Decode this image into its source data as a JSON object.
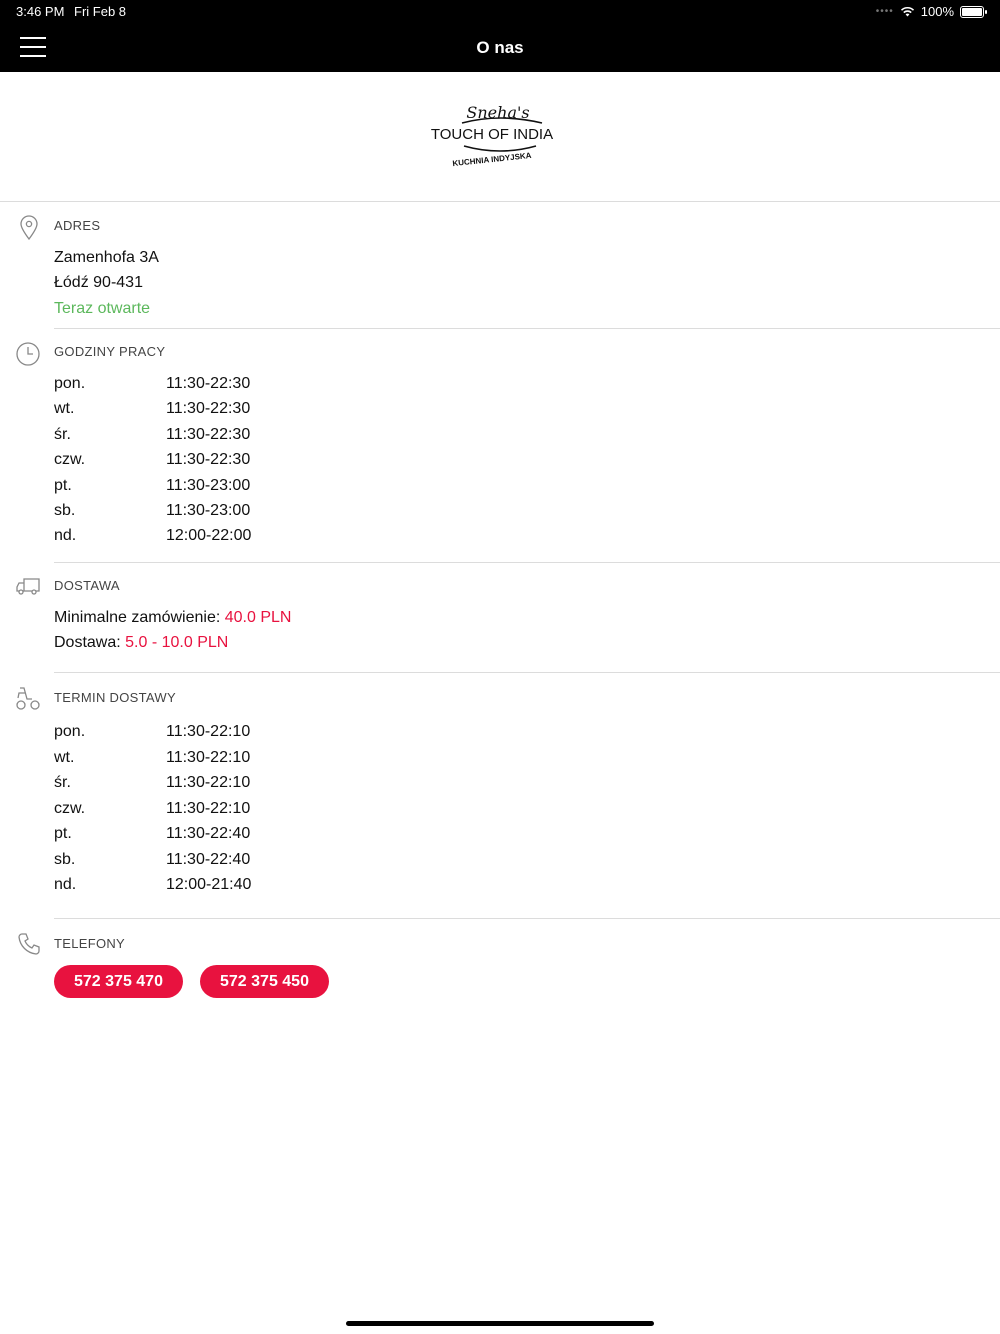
{
  "status_bar": {
    "time": "3:46 PM",
    "date": "Fri Feb 8",
    "battery": "100%"
  },
  "nav": {
    "title": "O nas"
  },
  "logo": {
    "script": "Sneha's",
    "name": "TOUCH OF INDIA",
    "tagline": "KUCHNIA INDYJSKA"
  },
  "address": {
    "title": "ADRES",
    "street": "Zamenhofa 3A",
    "city": "Łódź 90-431",
    "status": "Teraz otwarte"
  },
  "opening_hours": {
    "title": "GODZINY PRACY",
    "rows": [
      {
        "day": "pon.",
        "hours": "11:30-22:30"
      },
      {
        "day": "wt.",
        "hours": "11:30-22:30"
      },
      {
        "day": "śr.",
        "hours": "11:30-22:30"
      },
      {
        "day": "czw.",
        "hours": "11:30-22:30"
      },
      {
        "day": "pt.",
        "hours": "11:30-23:00"
      },
      {
        "day": "sb.",
        "hours": "11:30-23:00"
      },
      {
        "day": "nd.",
        "hours": "12:00-22:00"
      }
    ]
  },
  "delivery": {
    "title": "DOSTAWA",
    "min_order_label": "Minimalne zamówienie:",
    "min_order_value": "40.0 PLN",
    "fee_label": "Dostawa:",
    "fee_value": "5.0 - 10.0 PLN"
  },
  "delivery_hours": {
    "title": "TERMIN DOSTAWY",
    "rows": [
      {
        "day": "pon.",
        "hours": "11:30-22:10"
      },
      {
        "day": "wt.",
        "hours": "11:30-22:10"
      },
      {
        "day": "śr.",
        "hours": "11:30-22:10"
      },
      {
        "day": "czw.",
        "hours": "11:30-22:10"
      },
      {
        "day": "pt.",
        "hours": "11:30-22:40"
      },
      {
        "day": "sb.",
        "hours": "11:30-22:40"
      },
      {
        "day": "nd.",
        "hours": "12:00-21:40"
      }
    ]
  },
  "phones": {
    "title": "TELEFONY",
    "numbers": [
      "572 375 470",
      "572 375 450"
    ]
  },
  "colors": {
    "accent": "#e8123f",
    "open_status": "#5cb85c",
    "nav_bg": "#000000"
  }
}
